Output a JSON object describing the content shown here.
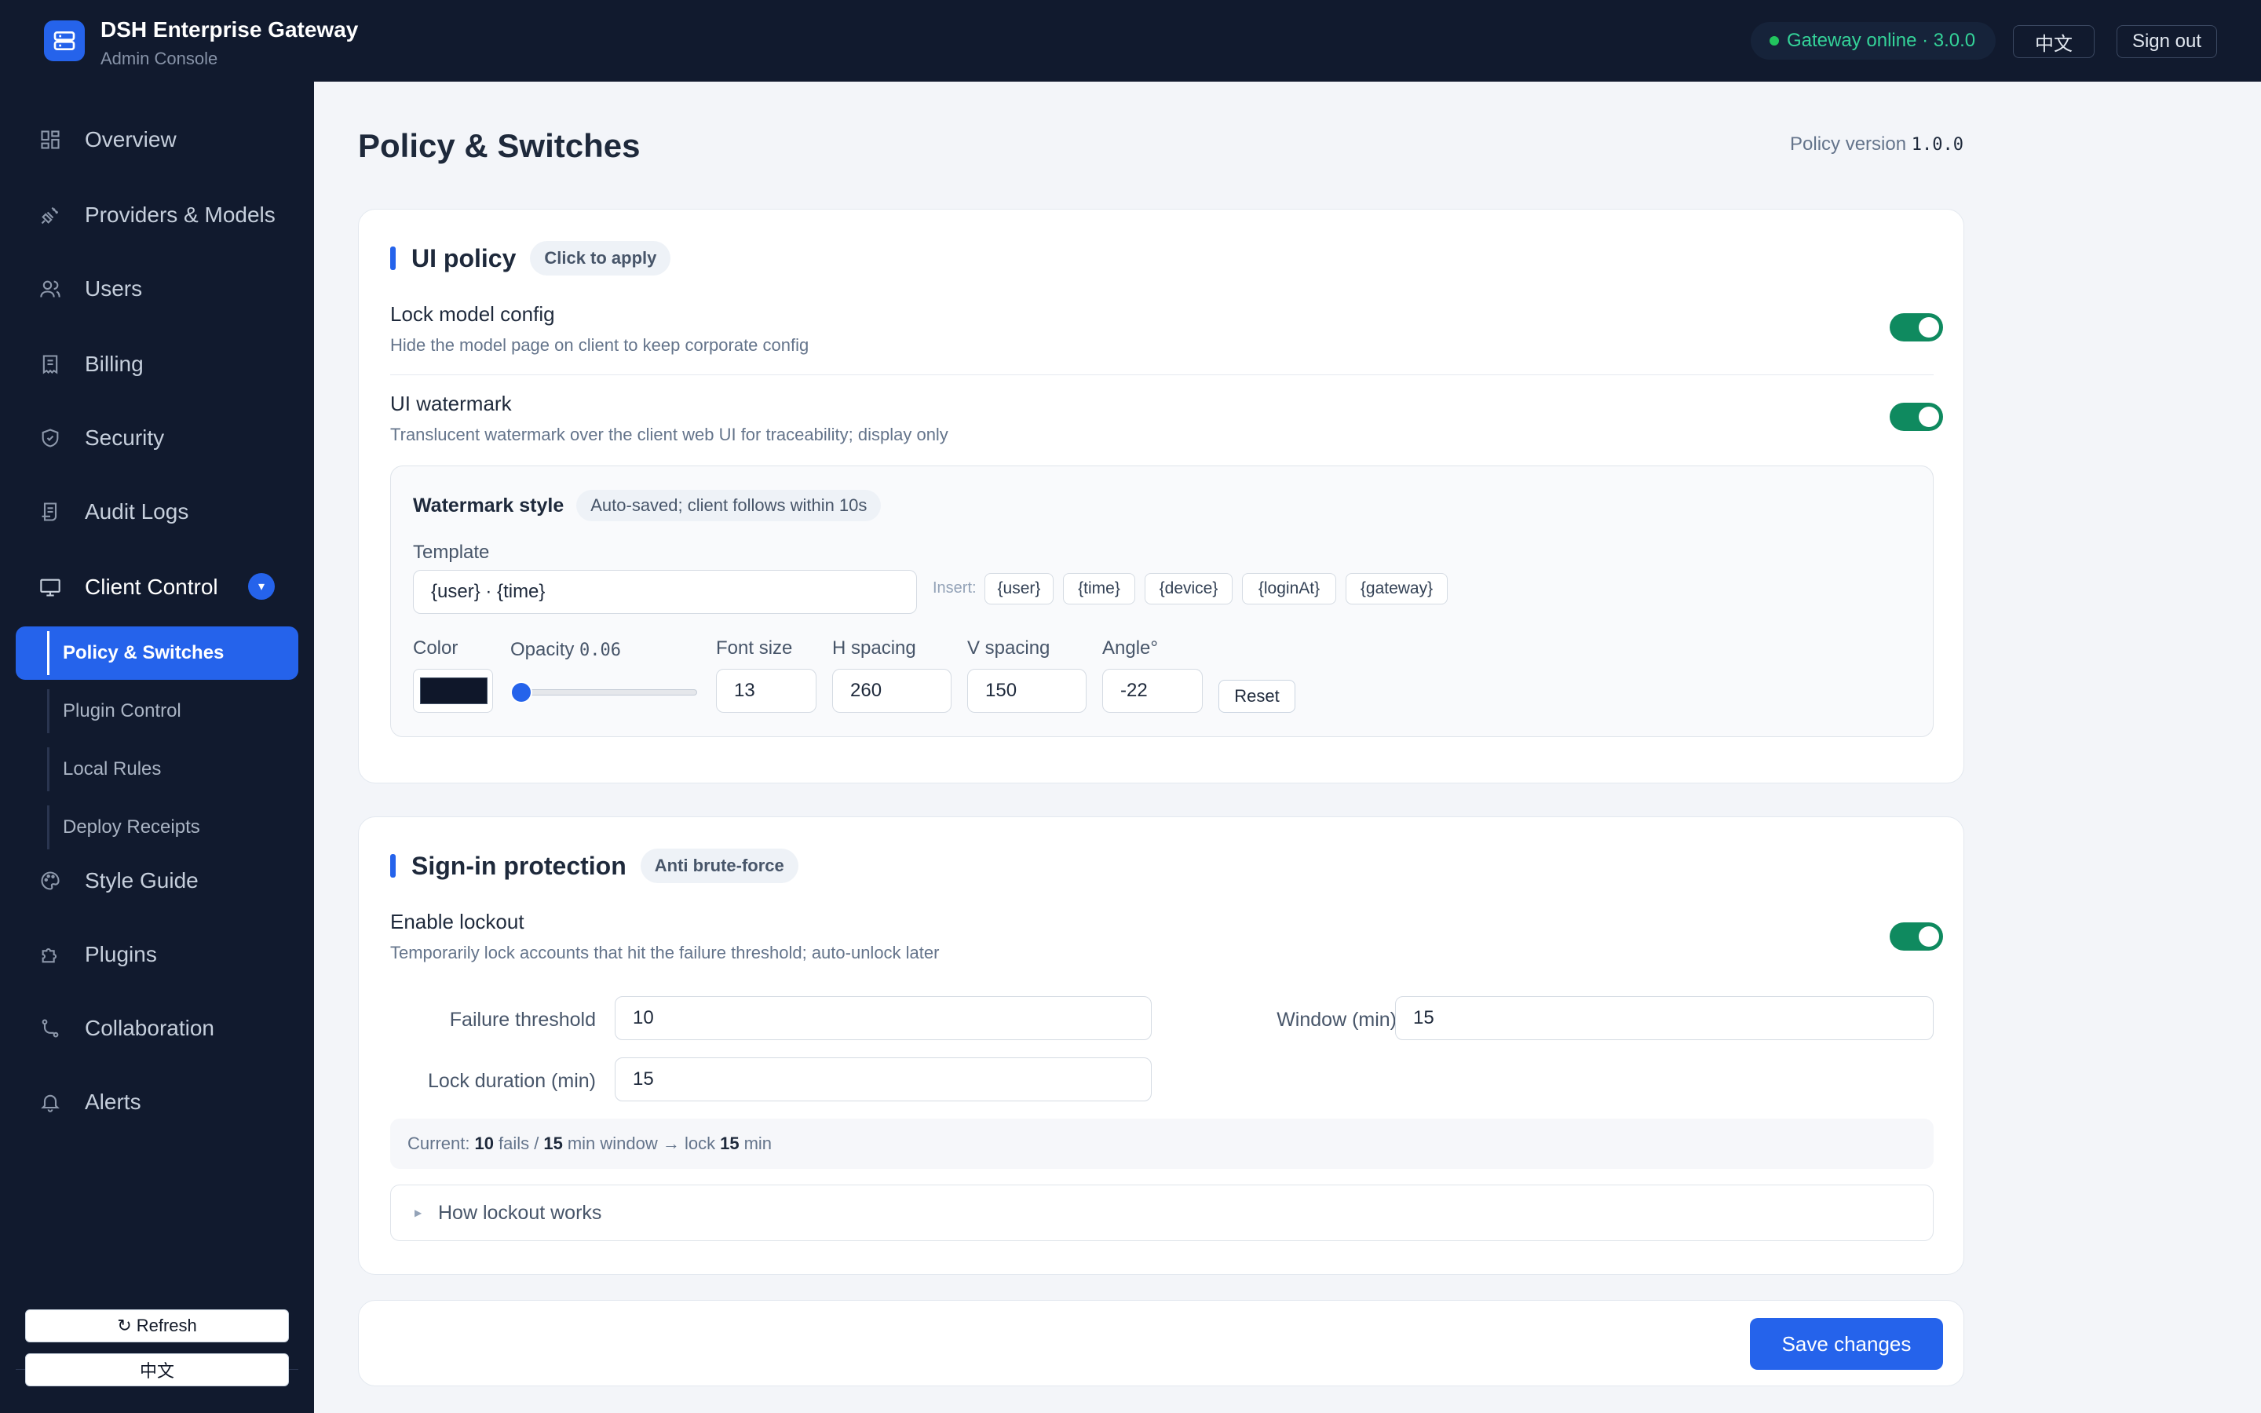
{
  "app": {
    "title": "DSH Enterprise Gateway",
    "subtitle": "Admin Console",
    "status": "Gateway online · 3.0.0",
    "lang_button": "中文",
    "signout_button": "Sign out"
  },
  "sidebar": {
    "items": [
      {
        "label": "Overview",
        "icon": "grid-icon"
      },
      {
        "label": "Providers & Models",
        "icon": "plug-icon"
      },
      {
        "label": "Users",
        "icon": "users-icon"
      },
      {
        "label": "Billing",
        "icon": "receipt-icon"
      },
      {
        "label": "Security",
        "icon": "shield-icon"
      },
      {
        "label": "Audit Logs",
        "icon": "log-icon"
      },
      {
        "label": "Client Control",
        "icon": "monitor-icon",
        "badge": "▾"
      },
      {
        "label": "Style Guide",
        "icon": "palette-icon"
      },
      {
        "label": "Plugins",
        "icon": "puzzle-icon"
      },
      {
        "label": "Collaboration",
        "icon": "branch-icon"
      },
      {
        "label": "Alerts",
        "icon": "bell-icon"
      }
    ],
    "sub_items": [
      {
        "label": "Policy & Switches",
        "active": true
      },
      {
        "label": "Plugin Control"
      },
      {
        "label": "Local Rules"
      },
      {
        "label": "Deploy Receipts"
      }
    ],
    "refresh_button": "↻ Refresh",
    "lang_button": "中文"
  },
  "page": {
    "title": "Policy & Switches",
    "version_label": "Policy version",
    "version_value": "1.0.0"
  },
  "ui_policy": {
    "title": "UI policy",
    "pill": "Click to apply",
    "lock_title": "Lock model config",
    "lock_desc": "Hide the model page on client to keep corporate config",
    "lock_on": true,
    "watermark_title": "UI watermark",
    "watermark_desc": "Translucent watermark over the client web UI for traceability; display only",
    "watermark_on": true,
    "style": {
      "title": "Watermark style",
      "pill": "Auto-saved; client follows within 10s",
      "template_label": "Template",
      "template_value": "{user} · {time}",
      "insert_label": "Insert:",
      "chips": [
        "{user}",
        "{time}",
        "{device}",
        "{loginAt}",
        "{gateway}"
      ],
      "color_label": "Color",
      "color_value": "#0f172a",
      "opacity_label": "Opacity",
      "opacity_value": "0.06",
      "fontsize_label": "Font size",
      "fontsize_value": "13",
      "hspacing_label": "H spacing",
      "hspacing_value": "260",
      "vspacing_label": "V spacing",
      "vspacing_value": "150",
      "angle_label": "Angle°",
      "angle_value": "-22",
      "reset_button": "Reset"
    }
  },
  "signin": {
    "title": "Sign-in protection",
    "pill": "Anti brute-force",
    "lockout_title": "Enable lockout",
    "lockout_desc": "Temporarily lock accounts that hit the failure threshold; auto-unlock later",
    "lockout_on": true,
    "threshold_label": "Failure threshold",
    "threshold_value": "10",
    "window_label": "Window (min)",
    "window_value": "15",
    "duration_label": "Lock duration (min)",
    "duration_value": "15",
    "summary_prefix": "Current:",
    "summary_fails": "10",
    "summary_fails_text": "fails /",
    "summary_window": "15",
    "summary_window_text": "min window → lock",
    "summary_lock": "15",
    "summary_lock_text": "min",
    "details_label": "How lockout works"
  },
  "footer": {
    "save_button": "Save changes"
  },
  "colors": {
    "accent": "#2563eb",
    "toggle_on": "#0f8a5f",
    "sidebar_bg": "#111a2e",
    "status_text": "#34d399"
  }
}
